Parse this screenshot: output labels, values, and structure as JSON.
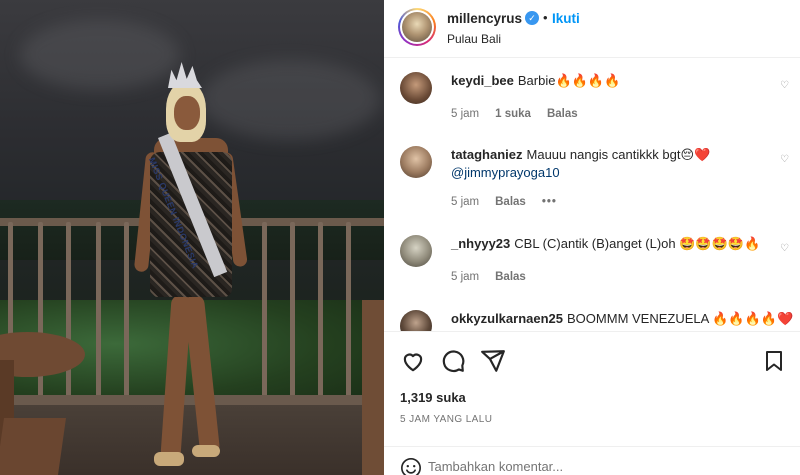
{
  "post": {
    "username": "millencyrus",
    "follow_label": "Ikuti",
    "location": "Pulau Bali",
    "dot": "•",
    "sash_text": "MISS QUEEN INDONESIA"
  },
  "comments": [
    {
      "user": "keydi_bee",
      "text": "Barbie🔥🔥🔥🔥",
      "mention": "",
      "time": "5 jam",
      "likes": "1 suka",
      "reply": "Balas",
      "more": ""
    },
    {
      "user": "tataghaniez",
      "text": "Mauuu nangis cantikkk bgt😔❤️",
      "mention": "@jimmyprayoga10",
      "time": "5 jam",
      "likes": "",
      "reply": "Balas",
      "more": "•••"
    },
    {
      "user": "_nhyyy23",
      "text": "CBL (C)antik (B)anget (L)oh 🤩🤩🤩🤩🔥",
      "mention": "",
      "time": "5 jam",
      "likes": "",
      "reply": "Balas",
      "more": ""
    },
    {
      "user": "okkyzulkarnaen25",
      "text": "BOOMMM VENEZUELA 🔥🔥🔥🔥❤️",
      "mention": "",
      "time": "",
      "likes": "",
      "reply": "",
      "more": ""
    }
  ],
  "actions": {
    "likes": "1,319 suka",
    "time": "5 JAM YANG LALU",
    "add_comment_placeholder": "Tambahkan komentar..."
  },
  "icons": {
    "like": "heart-icon",
    "comment": "comment-icon",
    "share": "share-icon",
    "save": "bookmark-icon",
    "emoji": "smile-icon",
    "verified": "verified-badge-icon"
  },
  "colors": {
    "link": "#0095f6",
    "verified": "#3897f0",
    "text": "#262626",
    "muted": "#737373"
  }
}
